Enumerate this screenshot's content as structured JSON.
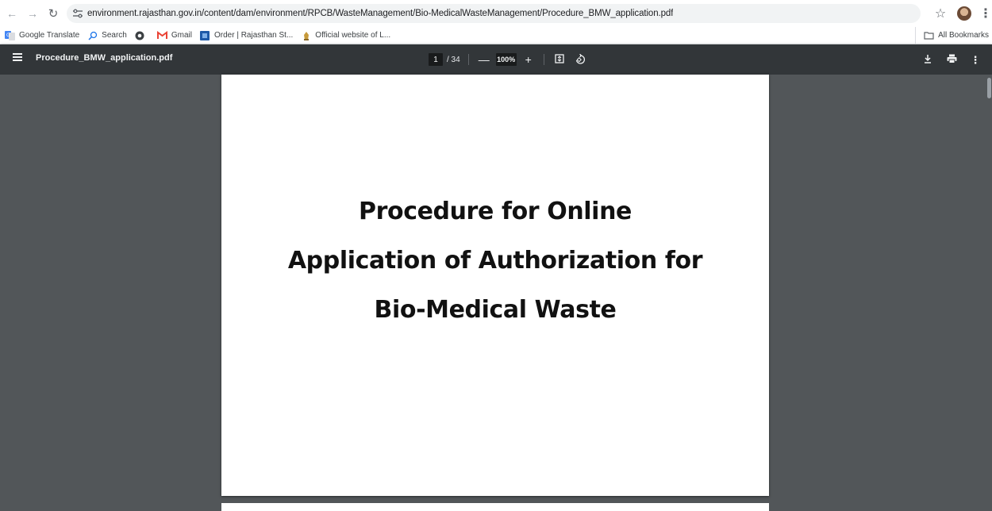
{
  "browser": {
    "url": "environment.rajasthan.gov.in/content/dam/environment/RPCB/WasteManagement/Bio-MedicalWasteManagement/Procedure_BMW_application.pdf",
    "bookmarks": [
      {
        "label": "Google Translate",
        "icon": "google-translate-icon"
      },
      {
        "label": "Search",
        "icon": "search-icon"
      },
      {
        "label": "",
        "icon": "chromium-icon"
      },
      {
        "label": "Gmail",
        "icon": "gmail-icon"
      },
      {
        "label": "Order | Rajasthan St...",
        "icon": "order-icon"
      },
      {
        "label": "Official website of L...",
        "icon": "emblem-icon"
      }
    ],
    "all_bookmarks": "All Bookmarks"
  },
  "pdf_viewer": {
    "filename": "Procedure_BMW_application.pdf",
    "current_page": "1",
    "total_pages": "/ 34",
    "zoom": "100%"
  },
  "document": {
    "title_lines": [
      "Procedure for Online",
      "Application of Authorization for",
      "Bio-Medical Waste"
    ]
  }
}
